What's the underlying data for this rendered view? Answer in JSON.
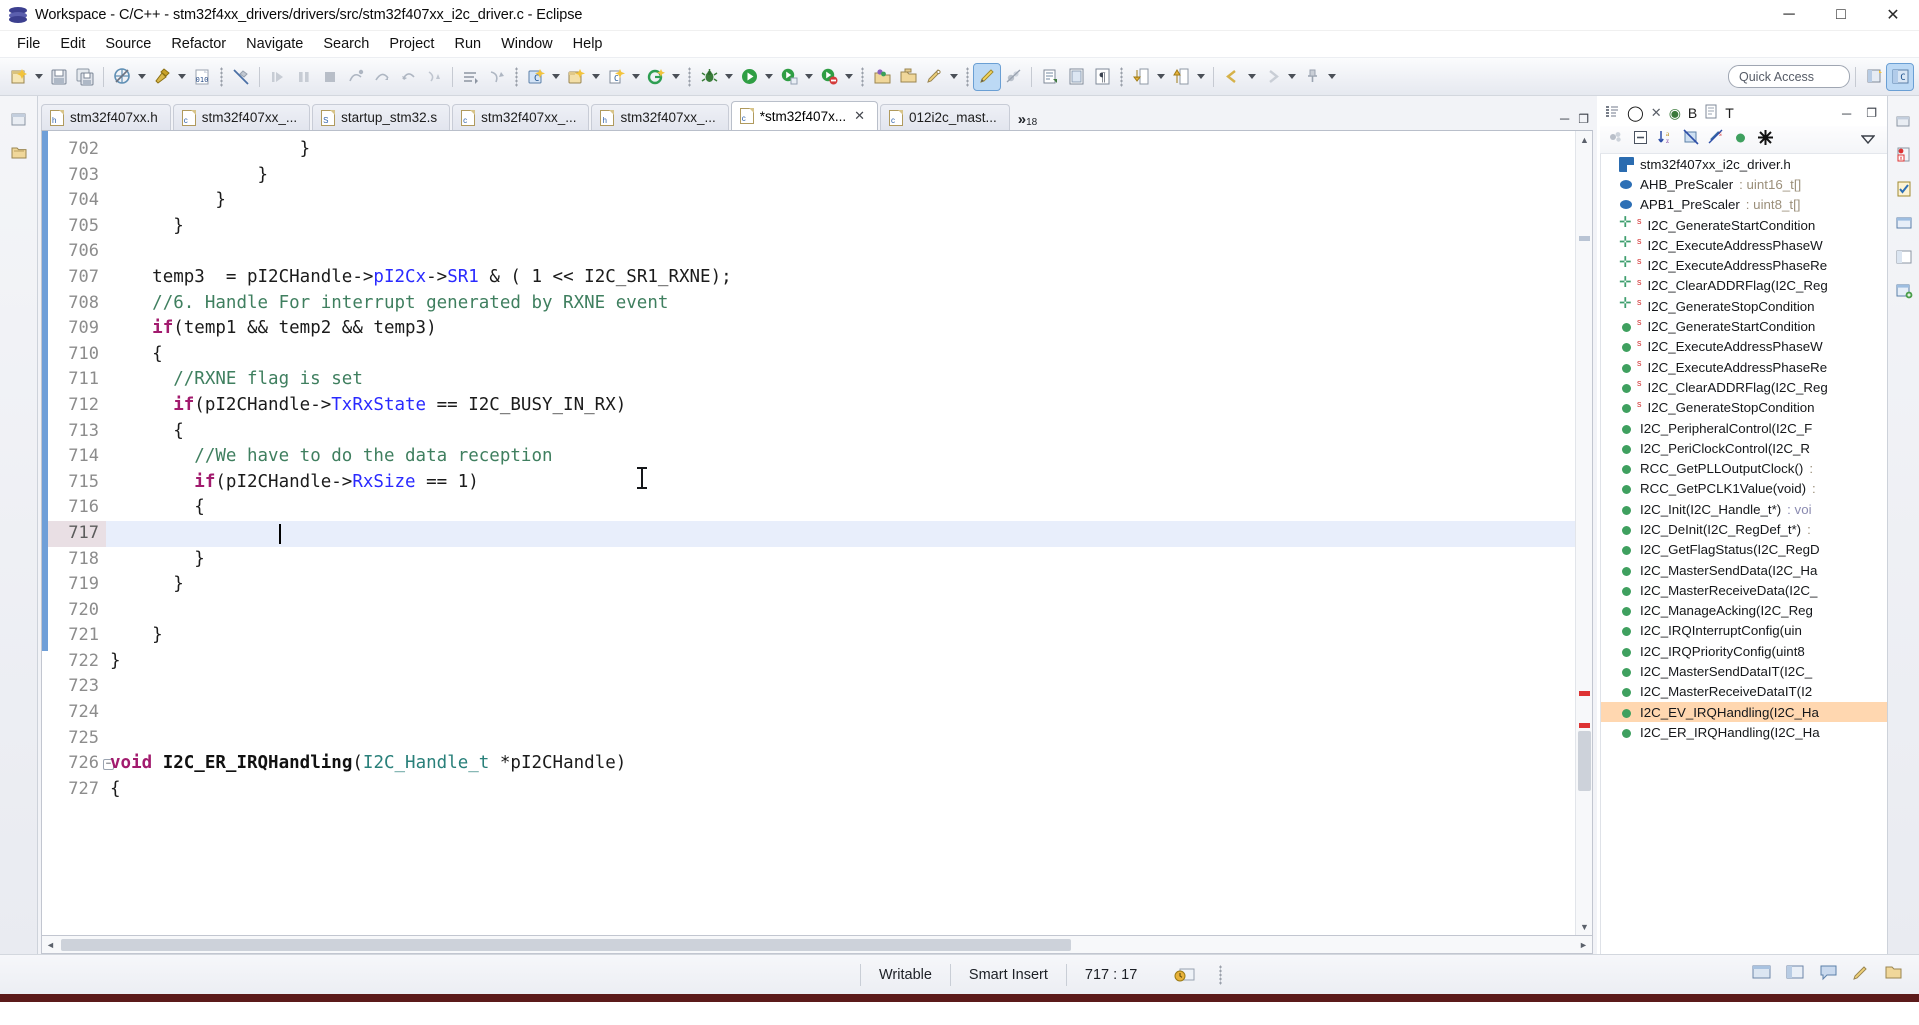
{
  "window": {
    "title": "Workspace - C/C++ - stm32f4xx_drivers/drivers/src/stm32f407xx_i2c_driver.c - Eclipse",
    "app_icon": "eclipse-icon",
    "minimize": "─",
    "maximize": "□",
    "close": "✕"
  },
  "menu": {
    "items": [
      {
        "label": "File",
        "accel": "F"
      },
      {
        "label": "Edit",
        "accel": "E"
      },
      {
        "label": "Source",
        "accel": "S"
      },
      {
        "label": "Refactor",
        "accel": "t"
      },
      {
        "label": "Navigate",
        "accel": "N"
      },
      {
        "label": "Search",
        "accel": "r"
      },
      {
        "label": "Project",
        "accel": "P"
      },
      {
        "label": "Run",
        "accel": "R"
      },
      {
        "label": "Window",
        "accel": "W"
      },
      {
        "label": "Help",
        "accel": "H"
      }
    ]
  },
  "toolbar": {
    "quick_access_placeholder": "Quick Access",
    "buttons": [
      "new-file-icon",
      "save-icon",
      "save-all-icon",
      "build-all-icon",
      "build-hammer-icon",
      "binary-icon",
      "no-build-icon",
      "resume-icon",
      "pause-icon",
      "terminate-icon",
      "step-into-icon",
      "step-over-icon",
      "step-return-icon",
      "drop-to-frame-icon",
      "next-edit-icon",
      "prev-edit-icon",
      "new-c-project-icon",
      "new-c-class-icon",
      "new-c-file-icon",
      "new-generic-icon",
      "debug-icon",
      "run-icon",
      "run-last-icon",
      "external-tools-icon",
      "open-type-icon",
      "open-folder-icon",
      "search-icon",
      "toggle-mark-occurrences-icon",
      "skip-breakpoints-icon",
      "open-declaration-icon",
      "toggle-block-icon",
      "show-whitespace-icon",
      "next-annotation-icon",
      "prev-annotation-icon",
      "back-icon",
      "forward-icon",
      "pin-icon"
    ],
    "perspective": [
      "open-perspective-icon",
      "cpp-perspective-icon"
    ]
  },
  "editor": {
    "tabs": [
      {
        "label": "stm32f407xx.h",
        "icon": "h-file-icon",
        "active": false,
        "dirty": false
      },
      {
        "label": "stm32f407xx_...",
        "icon": "c-file-icon",
        "active": false,
        "dirty": false
      },
      {
        "label": "startup_stm32.s",
        "icon": "s-file-icon",
        "active": false,
        "dirty": false
      },
      {
        "label": "stm32f407xx_...",
        "icon": "c-file-icon",
        "active": false,
        "dirty": false
      },
      {
        "label": "stm32f407xx_...",
        "icon": "h-file-icon",
        "active": false,
        "dirty": false
      },
      {
        "label": "*stm32f407x...",
        "icon": "c-file-icon",
        "active": true,
        "dirty": true
      },
      {
        "label": "012i2c_mast...",
        "icon": "c-file-icon",
        "active": false,
        "dirty": false
      }
    ],
    "overflow_chevron": "»",
    "overflow_count": "18",
    "close_glyph": "✕",
    "minimize_glyph": "─",
    "maximize_glyph": "❐",
    "lines": [
      {
        "no": "702",
        "indent": 18,
        "tokens": [
          {
            "t": "}",
            "c": "plain"
          }
        ]
      },
      {
        "no": "703",
        "indent": 14,
        "tokens": [
          {
            "t": "}",
            "c": "plain"
          }
        ]
      },
      {
        "no": "704",
        "indent": 10,
        "tokens": [
          {
            "t": "}",
            "c": "plain"
          }
        ]
      },
      {
        "no": "705",
        "indent": 6,
        "tokens": [
          {
            "t": "}",
            "c": "plain"
          }
        ]
      },
      {
        "no": "706",
        "indent": 0,
        "tokens": []
      },
      {
        "no": "707",
        "indent": 4,
        "tokens": [
          {
            "t": "temp3  = pI2CHandle->",
            "c": "plain"
          },
          {
            "t": "pI2Cx",
            "c": "fld"
          },
          {
            "t": "->",
            "c": "plain"
          },
          {
            "t": "SR1",
            "c": "fld"
          },
          {
            "t": " & ( 1 << I2C_SR1_RXNE);",
            "c": "plain"
          }
        ]
      },
      {
        "no": "708",
        "indent": 4,
        "tokens": [
          {
            "t": "//6. Handle For interrupt generated by RXNE event",
            "c": "cmt"
          }
        ]
      },
      {
        "no": "709",
        "indent": 4,
        "tokens": [
          {
            "t": "if",
            "c": "kw"
          },
          {
            "t": "(temp1 && temp2 && temp3)",
            "c": "plain"
          }
        ]
      },
      {
        "no": "710",
        "indent": 4,
        "tokens": [
          {
            "t": "{",
            "c": "plain"
          }
        ]
      },
      {
        "no": "711",
        "indent": 6,
        "tokens": [
          {
            "t": "//RXNE flag is set",
            "c": "cmt"
          }
        ]
      },
      {
        "no": "712",
        "indent": 6,
        "tokens": [
          {
            "t": "if",
            "c": "kw"
          },
          {
            "t": "(pI2CHandle->",
            "c": "plain"
          },
          {
            "t": "TxRxState",
            "c": "fld"
          },
          {
            "t": " == I2C_BUSY_IN_RX)",
            "c": "plain"
          }
        ]
      },
      {
        "no": "713",
        "indent": 6,
        "tokens": [
          {
            "t": "{",
            "c": "plain"
          }
        ]
      },
      {
        "no": "714",
        "indent": 8,
        "tokens": [
          {
            "t": "//We have to do the data reception",
            "c": "cmt"
          }
        ]
      },
      {
        "no": "715",
        "indent": 8,
        "tokens": [
          {
            "t": "if",
            "c": "kw"
          },
          {
            "t": "(pI2CHandle->",
            "c": "plain"
          },
          {
            "t": "RxSize",
            "c": "fld"
          },
          {
            "t": " == 1)",
            "c": "plain"
          }
        ]
      },
      {
        "no": "716",
        "indent": 8,
        "tokens": [
          {
            "t": "{",
            "c": "plain"
          }
        ]
      },
      {
        "no": "717",
        "indent": 0,
        "current": true,
        "tokens": []
      },
      {
        "no": "718",
        "indent": 8,
        "tokens": [
          {
            "t": "}",
            "c": "plain"
          }
        ]
      },
      {
        "no": "719",
        "indent": 6,
        "tokens": [
          {
            "t": "}",
            "c": "plain"
          }
        ]
      },
      {
        "no": "720",
        "indent": 0,
        "tokens": []
      },
      {
        "no": "721",
        "indent": 4,
        "tokens": [
          {
            "t": "}",
            "c": "plain"
          }
        ]
      },
      {
        "no": "722",
        "indent": 0,
        "tokens": [
          {
            "t": "}",
            "c": "plain"
          }
        ]
      },
      {
        "no": "723",
        "indent": 0,
        "tokens": []
      },
      {
        "no": "724",
        "indent": 0,
        "tokens": []
      },
      {
        "no": "725",
        "indent": 0,
        "tokens": []
      },
      {
        "no": "726",
        "indent": 0,
        "fold": true,
        "tokens": [
          {
            "t": "void",
            "c": "kw"
          },
          {
            "t": " ",
            "c": "plain"
          },
          {
            "t": "I2C_ER_IRQHandling",
            "c": "fn"
          },
          {
            "t": "(",
            "c": "plain"
          },
          {
            "t": "I2C_Handle_t",
            "c": "typ"
          },
          {
            "t": " *pI2CHandle)",
            "c": "plain"
          }
        ]
      },
      {
        "no": "727",
        "indent": 0,
        "tokens": [
          {
            "t": "{",
            "c": "plain"
          }
        ]
      }
    ]
  },
  "outline": {
    "view_tabs": [
      {
        "label": "O",
        "icon": "outline-icon"
      },
      {
        "label": "B",
        "icon": "build-targets-icon"
      },
      {
        "label": "T",
        "icon": "task-list-icon"
      }
    ],
    "tools": [
      "focus-active-task-icon",
      "collapse-all-icon",
      "sort-az-icon",
      "hide-fields-icon",
      "hide-static-icon",
      "hide-nonpublic-icon",
      "hide-macros-icon",
      "view-menu-icon"
    ],
    "items": [
      {
        "label": "stm32f407xx_i2c_driver.h",
        "icon": "hdr",
        "sig": "",
        "static": false
      },
      {
        "label": "AHB_PreScaler",
        "icon": "var",
        "sig": " : uint16_t[]",
        "static": false
      },
      {
        "label": "APB1_PreScaler",
        "icon": "var",
        "sig": " : uint8_t[]",
        "static": false
      },
      {
        "label": "I2C_GenerateStartCondition",
        "icon": "decl",
        "sig": "",
        "static": true
      },
      {
        "label": "I2C_ExecuteAddressPhaseW",
        "icon": "decl",
        "sig": "",
        "static": true
      },
      {
        "label": "I2C_ExecuteAddressPhaseRе",
        "icon": "decl",
        "sig": "",
        "static": true
      },
      {
        "label": "I2C_ClearADDRFlag(I2C_Reɡ",
        "icon": "decl",
        "sig": "",
        "static": true
      },
      {
        "label": "I2C_GenerateStopCondition",
        "icon": "decl",
        "sig": "",
        "static": true
      },
      {
        "label": "I2C_GenerateStartCondition",
        "icon": "def",
        "sig": "",
        "static": true
      },
      {
        "label": "I2C_ExecuteAddressPhaseW",
        "icon": "def",
        "sig": "",
        "static": true
      },
      {
        "label": "I2C_ExecuteAddressPhaseRе",
        "icon": "def",
        "sig": "",
        "static": true
      },
      {
        "label": "I2C_ClearADDRFlag(I2C_Reɡ",
        "icon": "def",
        "sig": "",
        "static": true
      },
      {
        "label": "I2C_GenerateStopCondition",
        "icon": "def",
        "sig": "",
        "static": true
      },
      {
        "label": "I2C_PeripheralControl(I2C_F",
        "icon": "def",
        "sig": "",
        "static": false
      },
      {
        "label": "I2C_PeriClockControl(I2C_R",
        "icon": "def",
        "sig": "",
        "static": false
      },
      {
        "label": "RCC_GetPLLOutputClock()",
        "icon": "def",
        "sig": " :",
        "static": false
      },
      {
        "label": "RCC_GetPCLK1Value(void)",
        "icon": "def",
        "sig": " :",
        "static": false
      },
      {
        "label": "I2C_Init(I2C_Handle_t*)",
        "icon": "def",
        "sig": " : voi",
        "static": false
      },
      {
        "label": "I2C_DeInit(I2C_RegDef_t*)",
        "icon": "def",
        "sig": " : ",
        "static": false
      },
      {
        "label": "I2C_GetFlagStatus(I2C_RegD",
        "icon": "def",
        "sig": "",
        "static": false
      },
      {
        "label": "I2C_MasterSendData(I2C_Hа",
        "icon": "def",
        "sig": "",
        "static": false
      },
      {
        "label": "I2C_MasterReceiveData(I2C_",
        "icon": "def",
        "sig": "",
        "static": false
      },
      {
        "label": "I2C_ManageAcking(I2C_Reɡ",
        "icon": "def",
        "sig": "",
        "static": false
      },
      {
        "label": "I2C_IRQInterruptConfig(uin",
        "icon": "def",
        "sig": "",
        "static": false
      },
      {
        "label": "I2C_IRQPriorityConfig(uint8",
        "icon": "def",
        "sig": "",
        "static": false
      },
      {
        "label": "I2C_MasterSendDataIT(I2C_",
        "icon": "def",
        "sig": "",
        "static": false
      },
      {
        "label": "I2C_MasterReceiveDataIT(I2",
        "icon": "def",
        "sig": "",
        "static": false
      },
      {
        "label": "I2C_EV_IRQHandling(I2C_Hа",
        "icon": "def",
        "sig": "",
        "static": false,
        "selected": true
      },
      {
        "label": "I2C_ER_IRQHandling(I2C_Hа",
        "icon": "def",
        "sig": "",
        "static": false
      }
    ]
  },
  "status": {
    "writable": "Writable",
    "insert_mode": "Smart Insert",
    "position": "717 : 17",
    "build_icon": "build-status-icon"
  }
}
